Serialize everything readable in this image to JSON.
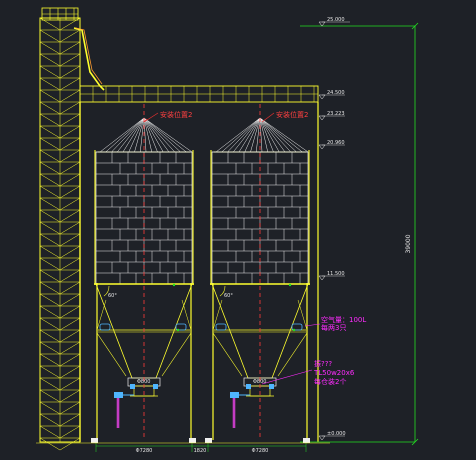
{
  "elevations": {
    "top": "25.000",
    "platform": "24.500",
    "roof_peak": "23.223",
    "eave": "20.960",
    "cone_top": "11.500",
    "ground": "±0.000"
  },
  "vertical_dimension": "39000",
  "callouts": {
    "install_left": "安装位置2",
    "install_right": "安装位置2",
    "air_tank_line1": "空气量：100L",
    "air_tank_line2": "每两3只",
    "vibrator_line1": "振???",
    "vibrator_line2": "TL50w20x6",
    "vibrator_line3": "每仓装2个"
  },
  "angles": {
    "left": "60°",
    "right": "60°"
  },
  "hopper_labels": {
    "left": "Φ800",
    "right": "Φ800"
  },
  "bottom_dimensions": {
    "left": "Φ7280",
    "gap": "1820",
    "right": "Φ7280"
  },
  "colors": {
    "background": "#1e2127",
    "structure": "#ffff2e",
    "outline": "#f0f0f0",
    "centerline": "#ff3b3b",
    "dimension": "#22e022",
    "annotation": "#ff2bff",
    "leader": "#e83030",
    "pipe": "#c43cc4",
    "equipment": "#4fb6ff"
  }
}
